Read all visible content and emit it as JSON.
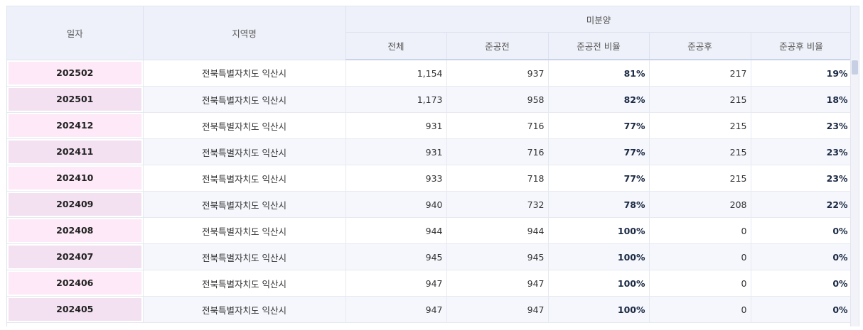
{
  "header": {
    "date_label": "일자",
    "region_label": "지역명",
    "group_label": "미분양",
    "sub_labels": [
      "전체",
      "준공전",
      "준공전 비율",
      "준공후",
      "준공후 비율"
    ]
  },
  "rows": [
    {
      "date": "202502",
      "region": "전북특별자치도 익산시",
      "total": "1,154",
      "pre": "937",
      "pre_ratio": "81%",
      "post": "217",
      "post_ratio": "19%"
    },
    {
      "date": "202501",
      "region": "전북특별자치도 익산시",
      "total": "1,173",
      "pre": "958",
      "pre_ratio": "82%",
      "post": "215",
      "post_ratio": "18%"
    },
    {
      "date": "202412",
      "region": "전북특별자치도 익산시",
      "total": "931",
      "pre": "716",
      "pre_ratio": "77%",
      "post": "215",
      "post_ratio": "23%"
    },
    {
      "date": "202411",
      "region": "전북특별자치도 익산시",
      "total": "931",
      "pre": "716",
      "pre_ratio": "77%",
      "post": "215",
      "post_ratio": "23%"
    },
    {
      "date": "202410",
      "region": "전북특별자치도 익산시",
      "total": "933",
      "pre": "718",
      "pre_ratio": "77%",
      "post": "215",
      "post_ratio": "23%"
    },
    {
      "date": "202409",
      "region": "전북특별자치도 익산시",
      "total": "940",
      "pre": "732",
      "pre_ratio": "78%",
      "post": "208",
      "post_ratio": "22%"
    },
    {
      "date": "202408",
      "region": "전북특별자치도 익산시",
      "total": "944",
      "pre": "944",
      "pre_ratio": "100%",
      "post": "0",
      "post_ratio": "0%"
    },
    {
      "date": "202407",
      "region": "전북특별자치도 익산시",
      "total": "945",
      "pre": "945",
      "pre_ratio": "100%",
      "post": "0",
      "post_ratio": "0%"
    },
    {
      "date": "202406",
      "region": "전북특별자치도 익산시",
      "total": "947",
      "pre": "947",
      "pre_ratio": "100%",
      "post": "0",
      "post_ratio": "0%"
    },
    {
      "date": "202405",
      "region": "전북특별자치도 익산시",
      "total": "947",
      "pre": "947",
      "pre_ratio": "100%",
      "post": "0",
      "post_ratio": "0%"
    }
  ]
}
